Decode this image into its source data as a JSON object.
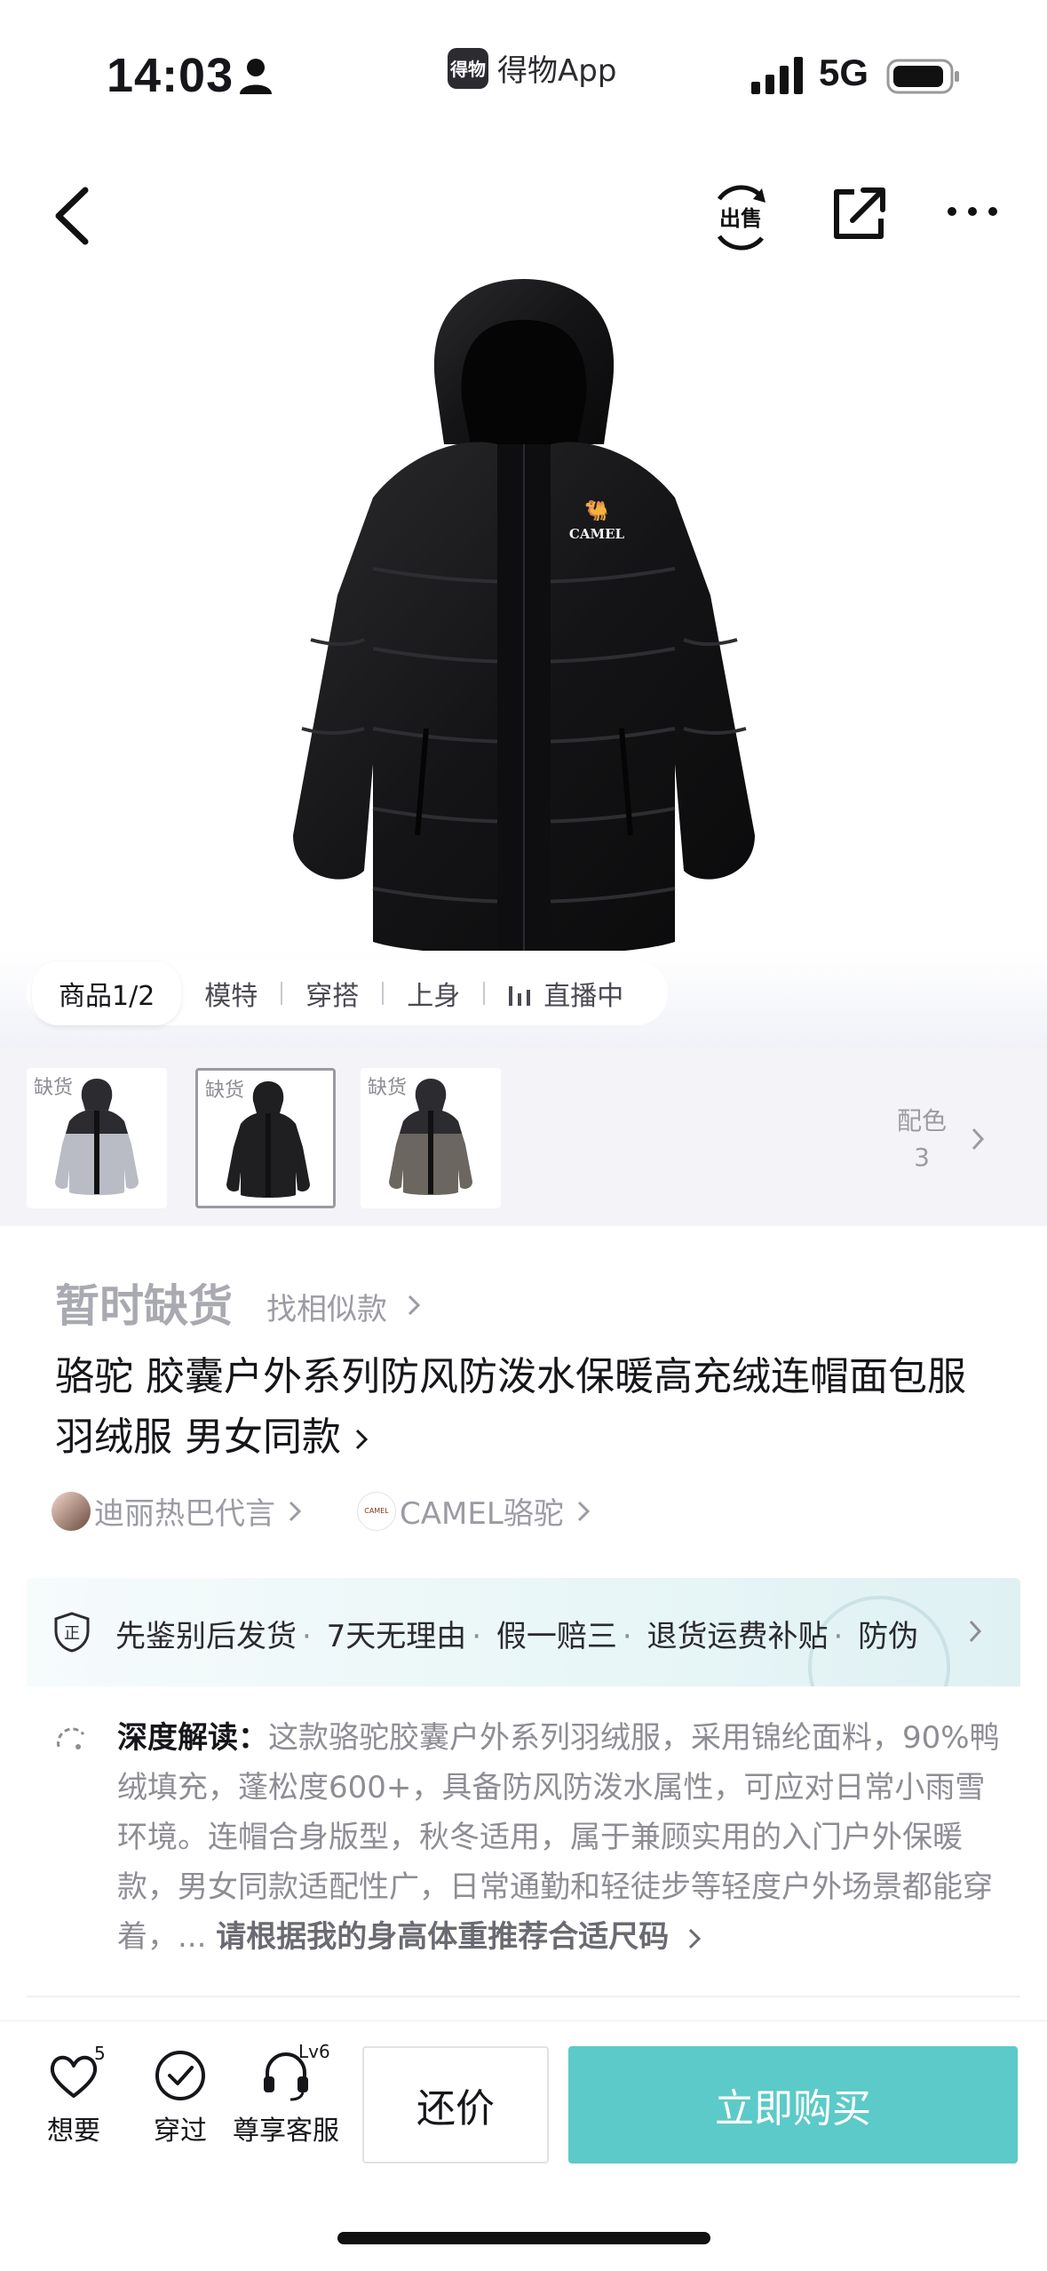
{
  "status_bar": {
    "time": "14:03",
    "app_badge": "得物",
    "app_name": "得物App",
    "network": "5G"
  },
  "nav": {
    "icons": [
      "back-icon",
      "sell-icon",
      "share-icon",
      "more-icon"
    ]
  },
  "media_tabs": [
    {
      "label": "商品1/2",
      "active": true
    },
    {
      "label": "模特"
    },
    {
      "label": "穿搭"
    },
    {
      "label": "上身"
    },
    {
      "label": "直播中"
    }
  ],
  "swatches": {
    "items": [
      {
        "tag": "缺货",
        "body_color": "#b9bcc4",
        "shoulder_color": "#2b2b30",
        "selected": false
      },
      {
        "tag": "缺货",
        "body_color": "#1f1f22",
        "shoulder_color": "#1f1f22",
        "selected": true
      },
      {
        "tag": "缺货",
        "body_color": "#6b6660",
        "shoulder_color": "#2b2b30",
        "selected": false
      }
    ],
    "colors_label": "配色",
    "colors_count": "3"
  },
  "product": {
    "status": "暂时缺货",
    "similar": "找相似款",
    "title": "骆驼 胶囊户外系列防风防泼水保暖高充绒连帽面包服 羽绒服 男女同款",
    "ambassador": "迪丽热巴代言",
    "brand": "CAMEL骆驼",
    "brand_logo_text": "CAMEL"
  },
  "hero": {
    "logo_text": "CAMEL"
  },
  "guarantee": {
    "items": [
      "先鉴别后发货",
      "7天无理由",
      "假一赔三",
      "退货运费补贴",
      "防伪"
    ]
  },
  "analysis": {
    "label": "深度解读：",
    "text": "这款骆驼胶囊户外系列羽绒服，采用锦纶面料，90%鸭绒填充，蓬松度600+，具备防风防泼水属性，可应对日常小雨雪环境。连帽合身版型，秋冬适用，属于兼顾实用的入门户外保暖款，男女同款适配性广，日常通勤和轻徒步等轻度户外场景都能穿着，... ",
    "cta": "请根据我的身高体重推荐合适尺码"
  },
  "bottom_bar": {
    "want_label": "想要",
    "want_count": "5",
    "worn_label": "穿过",
    "service_label": "尊享客服",
    "service_level": "Lv6",
    "bargain_label": "还价",
    "buy_label": "立即购买"
  },
  "colors": {
    "accent": "#5ccac8",
    "muted": "#9b9ba3"
  }
}
